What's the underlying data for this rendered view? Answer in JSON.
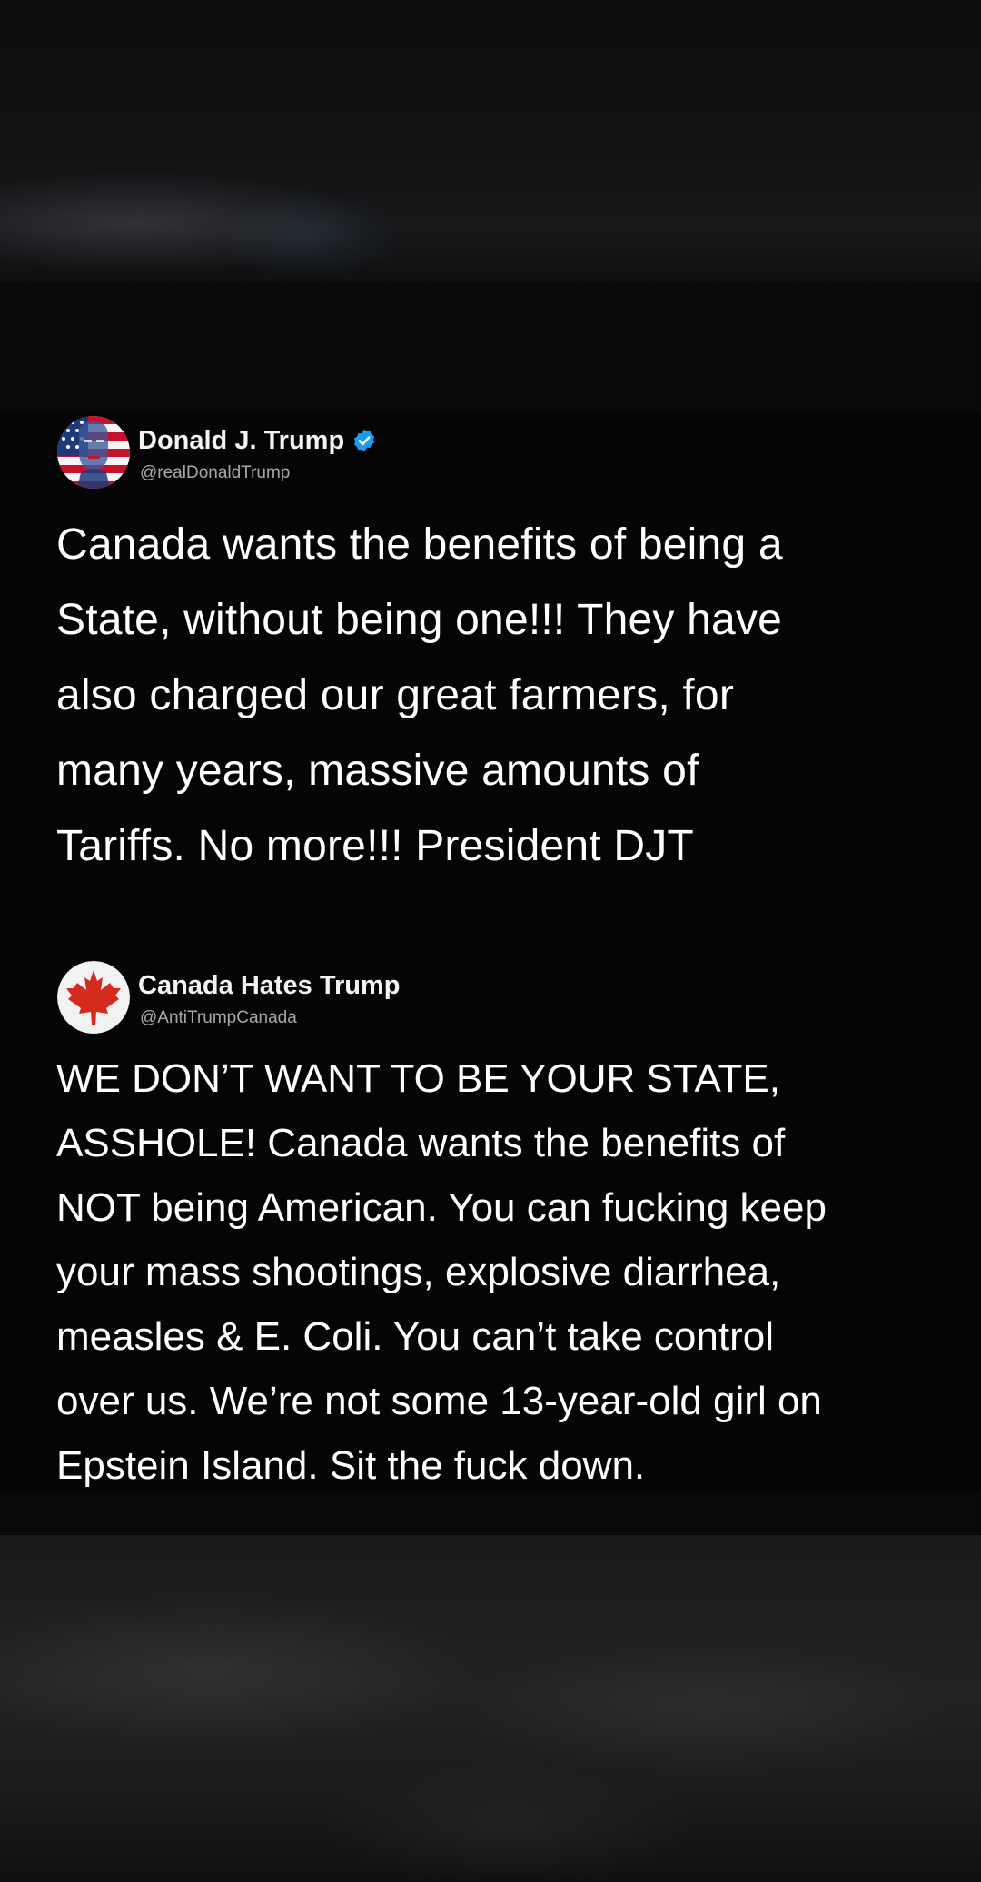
{
  "tweets": [
    {
      "display_name": "Donald J. Trump",
      "handle": "@realDonaldTrump",
      "verified": true,
      "avatar_icon": "american-flag-portrait-avatar",
      "body_lines": [
        "Canada wants the benefits of being a",
        "State, without being one!!! They have",
        "also charged our great farmers, for",
        "many years, massive amounts of",
        "Tariffs. No more!!! President DJT"
      ]
    },
    {
      "display_name": "Canada Hates Trump",
      "handle": "@AntiTrumpCanada",
      "verified": false,
      "avatar_icon": "maple-leaf-avatar",
      "body_lines": [
        "WE DON’T WANT TO BE YOUR STATE,",
        "ASSHOLE! Canada wants the benefits of",
        "NOT being American. You can fucking keep",
        "your mass shootings, explosive diarrhea,",
        "measles & E. Coli. You can’t take control",
        "over us. We’re not some 13-year-old girl on",
        "Epstein Island. Sit the fuck down."
      ]
    }
  ],
  "colors": {
    "background": "#050505",
    "text": "#ffffff",
    "handle": "#a8a8a8",
    "verified_badge": "#1d9bf0",
    "maple_leaf": "#d52b1e"
  }
}
